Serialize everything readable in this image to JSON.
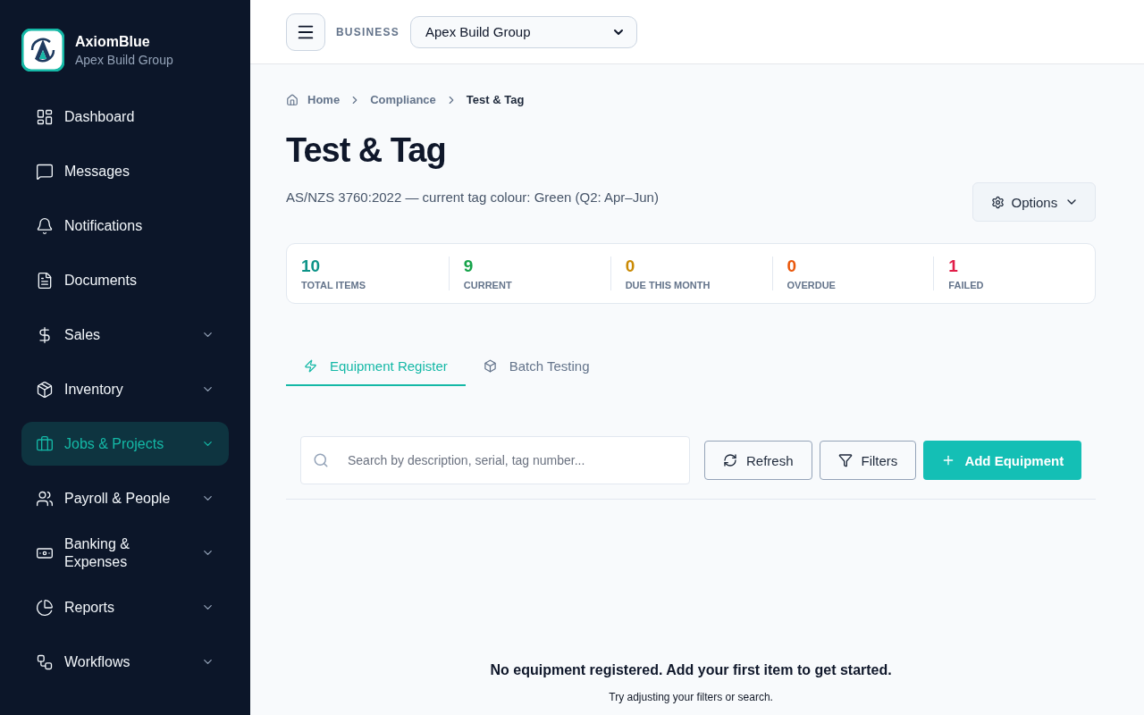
{
  "brand": {
    "name": "AxiomBlue",
    "subtitle": "Apex Build Group"
  },
  "sidebar": {
    "items": [
      {
        "kind": "dashboard",
        "label": "Dashboard",
        "expandable": false,
        "selected": false
      },
      {
        "kind": "messages",
        "label": "Messages",
        "expandable": false,
        "selected": false
      },
      {
        "kind": "notifications",
        "label": "Notifications",
        "expandable": false,
        "selected": false
      },
      {
        "kind": "documents",
        "label": "Documents",
        "expandable": false,
        "selected": false
      },
      {
        "kind": "sales",
        "label": "Sales",
        "expandable": true,
        "selected": false
      },
      {
        "kind": "inventory",
        "label": "Inventory",
        "expandable": true,
        "selected": false
      },
      {
        "kind": "jobs",
        "label": "Jobs & Projects",
        "expandable": true,
        "selected": true
      },
      {
        "kind": "payroll",
        "label": "Payroll & People",
        "expandable": true,
        "selected": false
      },
      {
        "kind": "banking",
        "label": "Banking & Expenses",
        "expandable": true,
        "selected": false
      },
      {
        "kind": "reports",
        "label": "Reports",
        "expandable": true,
        "selected": false
      },
      {
        "kind": "workflows",
        "label": "Workflows",
        "expandable": true,
        "selected": false
      }
    ]
  },
  "header": {
    "business_label": "BUSINESS",
    "business_value": "Apex Build Group"
  },
  "breadcrumb": [
    "Home",
    "Compliance",
    "Test & Tag"
  ],
  "page": {
    "title": "Test & Tag",
    "subtitle": "AS/NZS 3760:2022 — current tag colour: Green (Q2: Apr–Jun)",
    "options_button": "Options"
  },
  "stats": [
    {
      "value": "10",
      "label": "TOTAL ITEMS",
      "color": "#0d9488"
    },
    {
      "value": "9",
      "label": "CURRENT",
      "color": "#16a34a"
    },
    {
      "value": "0",
      "label": "DUE THIS MONTH",
      "color": "#ca8a04"
    },
    {
      "value": "0",
      "label": "OVERDUE",
      "color": "#ea580c"
    },
    {
      "value": "1",
      "label": "FAILED",
      "color": "#e11d48"
    }
  ],
  "tabs": [
    {
      "kind": "equipment",
      "label": "Equipment Register",
      "selected": true
    },
    {
      "kind": "batch",
      "label": "Batch Testing",
      "selected": false
    }
  ],
  "toolbar": {
    "search_placeholder": "Search by description, serial, tag number...",
    "refresh": "Refresh",
    "filters": "Filters",
    "add": "Add Equipment"
  },
  "empty_state": {
    "title": "No equipment registered. Add your first item to get started.",
    "hint": "Try adjusting your filters or search."
  }
}
